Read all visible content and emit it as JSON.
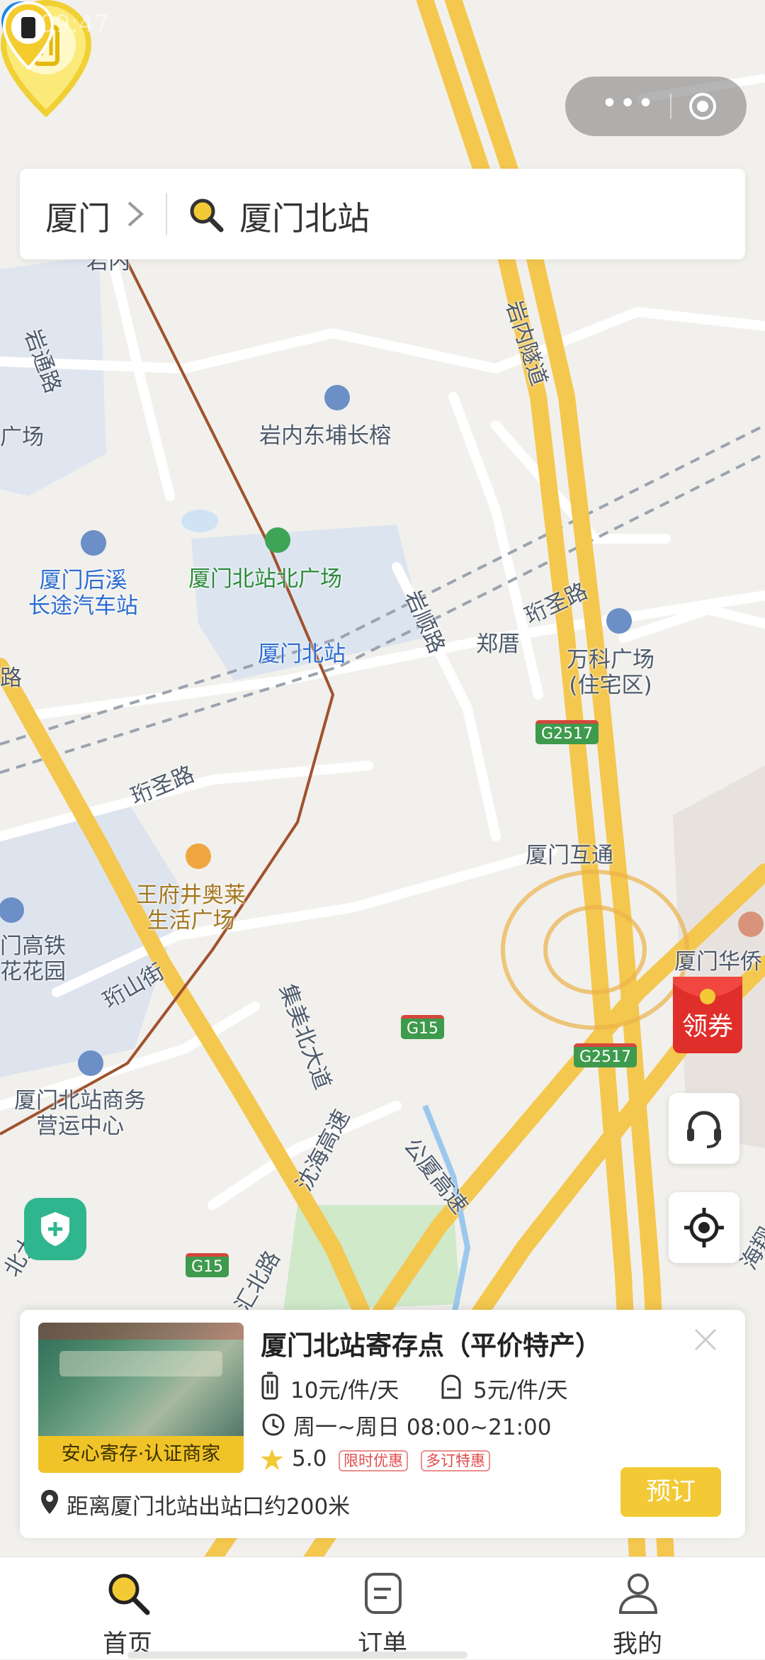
{
  "status_bar": {
    "time": "09:47"
  },
  "capsule": {
    "more_glyph": "•••"
  },
  "search": {
    "city": "厦门",
    "query": "厦门北站"
  },
  "map_labels": {
    "yannei": "岩内",
    "yantong_rd": "岩通路",
    "guangchang": "广场",
    "yannei_dongpu": "岩内东埔长榕",
    "yannei_tunnel": "岩内隧道",
    "houxi_station": "厦门后溪\n长途汽车站",
    "north_plaza": "厦门北站北广场",
    "xiamen_north": "厦门北站",
    "yanshun_rd": "岩顺路",
    "zhengcuo": "郑厝",
    "jiansheng_rd_ne": "珩圣路",
    "vanke": "万科广场\n(住宅区)",
    "g2517_a": "G2517",
    "jiansheng_rd": "珩圣路",
    "wangfujing": "王府井奥莱\n生活广场",
    "hutong": "厦门互通",
    "huaqiao": "厦门华侨",
    "gaotie_garden": "门高铁\n花花园",
    "jianshan_st": "珩山街",
    "jimei_north": "集美北大道",
    "g15_a": "G15",
    "g2517_b": "G2517",
    "business_center": "厦门北站商务\n营运中心",
    "shenhai_exp": "沈海高速",
    "gongxia_exp": "公厦高速",
    "g15_b": "G15",
    "road_bottom": "汇北路",
    "road_left": "北大",
    "road_right": "海翔",
    "road_lu": "路"
  },
  "coupon": {
    "label": "领券"
  },
  "card": {
    "title": "厦门北站寄存点（平价特产）",
    "badge": "安心寄存·认证商家",
    "price_luggage": "10元/件/天",
    "price_bag": "5元/件/天",
    "hours": "周一~周日 08:00~21:00",
    "rating": "5.0",
    "tag_limited": "限时优惠",
    "tag_multi": "多订特惠",
    "distance": "距离厦门北站出站口约200米",
    "book_label": "预订"
  },
  "tabs": [
    {
      "label": "首页",
      "icon": "search-icon"
    },
    {
      "label": "订单",
      "icon": "order-icon"
    },
    {
      "label": "我的",
      "icon": "user-icon"
    }
  ],
  "colors": {
    "accent": "#F3C936",
    "pin": "#F0D034",
    "blue_pin": "#1E88E5",
    "safety": "#30B68E"
  }
}
